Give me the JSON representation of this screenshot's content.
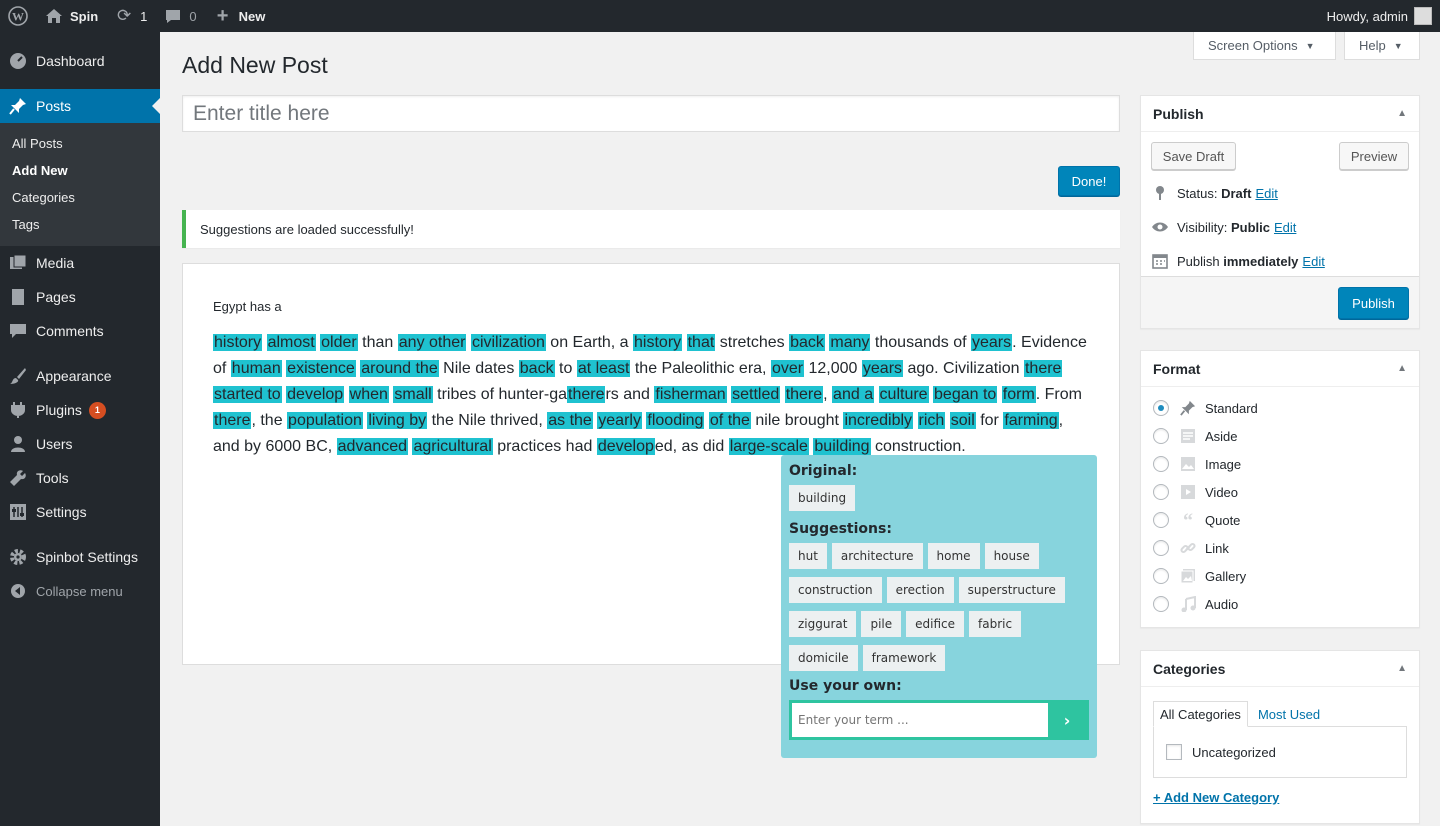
{
  "adminbar": {
    "site_name": "Spin",
    "updates_count": "1",
    "comments_count": "0",
    "new_label": "New",
    "greeting": "Howdy, admin"
  },
  "sidebar": {
    "dashboard": "Dashboard",
    "posts": "Posts",
    "submenu": [
      "All Posts",
      "Add New",
      "Categories",
      "Tags"
    ],
    "media": "Media",
    "pages": "Pages",
    "comments": "Comments",
    "appearance": "Appearance",
    "plugins": "Plugins",
    "plugins_badge": "1",
    "users": "Users",
    "tools": "Tools",
    "settings": "Settings",
    "spinbot": "Spinbot Settings",
    "collapse": "Collapse menu"
  },
  "screen_options": {
    "label": "Screen Options",
    "help": "Help"
  },
  "page": {
    "title": "Add New Post",
    "title_placeholder": "Enter title here",
    "done_label": "Done!",
    "notice": "Suggestions are loaded successfully!"
  },
  "editor": {
    "intro": "Egypt has a",
    "segments": [
      [
        "history",
        true
      ],
      [
        " ",
        false
      ],
      [
        "almost",
        true
      ],
      [
        " ",
        false
      ],
      [
        "older",
        true
      ],
      [
        " than ",
        false
      ],
      [
        "any other",
        true
      ],
      [
        " ",
        false
      ],
      [
        "civilization",
        true
      ],
      [
        " on Earth, a ",
        false
      ],
      [
        "history",
        true
      ],
      [
        " ",
        false
      ],
      [
        "that",
        true
      ],
      [
        " stretches ",
        false
      ],
      [
        "back",
        true
      ],
      [
        " ",
        false
      ],
      [
        "many",
        true
      ],
      [
        " thousands of ",
        false
      ],
      [
        "years",
        true
      ],
      [
        ". Evidence of ",
        false
      ],
      [
        "human",
        true
      ],
      [
        " ",
        false
      ],
      [
        "existence",
        true
      ],
      [
        " ",
        false
      ],
      [
        "around the",
        true
      ],
      [
        " Nile dates ",
        false
      ],
      [
        "back",
        true
      ],
      [
        " to ",
        false
      ],
      [
        "at least",
        true
      ],
      [
        " the Paleolithic era, ",
        false
      ],
      [
        "over",
        true
      ],
      [
        " 12,000 ",
        false
      ],
      [
        "years",
        true
      ],
      [
        " ago. Civilization ",
        false
      ],
      [
        "there",
        true
      ],
      [
        " ",
        false
      ],
      [
        "started to",
        true
      ],
      [
        " ",
        false
      ],
      [
        "develop",
        true
      ],
      [
        " ",
        false
      ],
      [
        "when",
        true
      ],
      [
        " ",
        false
      ],
      [
        "small",
        true
      ],
      [
        " tribes of hunter-ga",
        false
      ],
      [
        "there",
        true
      ],
      [
        "rs and ",
        false
      ],
      [
        "fisherman",
        true
      ],
      [
        " ",
        false
      ],
      [
        "settled",
        true
      ],
      [
        " ",
        false
      ],
      [
        "there",
        true
      ],
      [
        ", ",
        false
      ],
      [
        "and a",
        true
      ],
      [
        " ",
        false
      ],
      [
        "culture",
        true
      ],
      [
        " ",
        false
      ],
      [
        "began to",
        true
      ],
      [
        " ",
        false
      ],
      [
        "form",
        true
      ],
      [
        ". From ",
        false
      ],
      [
        "there",
        true
      ],
      [
        ", the ",
        false
      ],
      [
        "population",
        true
      ],
      [
        " ",
        false
      ],
      [
        "living by",
        true
      ],
      [
        " the Nile thrived, ",
        false
      ],
      [
        "as the",
        true
      ],
      [
        " ",
        false
      ],
      [
        "yearly",
        true
      ],
      [
        " ",
        false
      ],
      [
        "flooding",
        true
      ],
      [
        " ",
        false
      ],
      [
        "of the",
        true
      ],
      [
        " nile brought ",
        false
      ],
      [
        "incredibly",
        true
      ],
      [
        " ",
        false
      ],
      [
        "rich",
        true
      ],
      [
        " ",
        false
      ],
      [
        "soil",
        true
      ],
      [
        " for ",
        false
      ],
      [
        "farming",
        true
      ],
      [
        ", and by 6000 BC, ",
        false
      ],
      [
        "advanced",
        true
      ],
      [
        " ",
        false
      ],
      [
        "agricultural",
        true
      ],
      [
        " practices had ",
        false
      ],
      [
        "develop",
        true
      ],
      [
        "ed, as did ",
        false
      ],
      [
        "large-scale",
        true
      ],
      [
        " ",
        false
      ],
      [
        "building",
        true
      ],
      [
        " construction.",
        false
      ]
    ]
  },
  "popup": {
    "original_label": "Original:",
    "original": "building",
    "suggestions_label": "Suggestions:",
    "suggestions": [
      "hut",
      "architecture",
      "home",
      "house",
      "construction",
      "erection",
      "superstructure",
      "ziggurat",
      "pile",
      "edifice",
      "fabric",
      "domicile",
      "framework"
    ],
    "own_label": "Use your own:",
    "own_placeholder": "Enter your term ...",
    "go": "›",
    "accent": "#2ec4a0"
  },
  "publish": {
    "title": "Publish",
    "save_draft": "Save Draft",
    "preview": "Preview",
    "status_label": "Status:",
    "status_value": "Draft",
    "visibility_label": "Visibility:",
    "visibility_value": "Public",
    "schedule_label": "Publish",
    "schedule_value": "immediately",
    "edit": "Edit",
    "publish_btn": "Publish"
  },
  "format": {
    "title": "Format",
    "options": [
      {
        "label": "Standard",
        "icon": "pin-icon",
        "selected": true
      },
      {
        "label": "Aside",
        "icon": "aside-icon",
        "selected": false
      },
      {
        "label": "Image",
        "icon": "image-icon",
        "selected": false
      },
      {
        "label": "Video",
        "icon": "video-icon",
        "selected": false
      },
      {
        "label": "Quote",
        "icon": "quote-icon",
        "selected": false
      },
      {
        "label": "Link",
        "icon": "link-icon",
        "selected": false
      },
      {
        "label": "Gallery",
        "icon": "gallery-icon",
        "selected": false
      },
      {
        "label": "Audio",
        "icon": "audio-icon",
        "selected": false
      }
    ]
  },
  "categories": {
    "title": "Categories",
    "tab_all": "All Categories",
    "tab_used": "Most Used",
    "item": "Uncategorized",
    "add_new": "+ Add New Category"
  },
  "colors": {
    "highlight": "#1fc2d0",
    "primary": "#0085ba",
    "sidebar": "#23282d"
  }
}
